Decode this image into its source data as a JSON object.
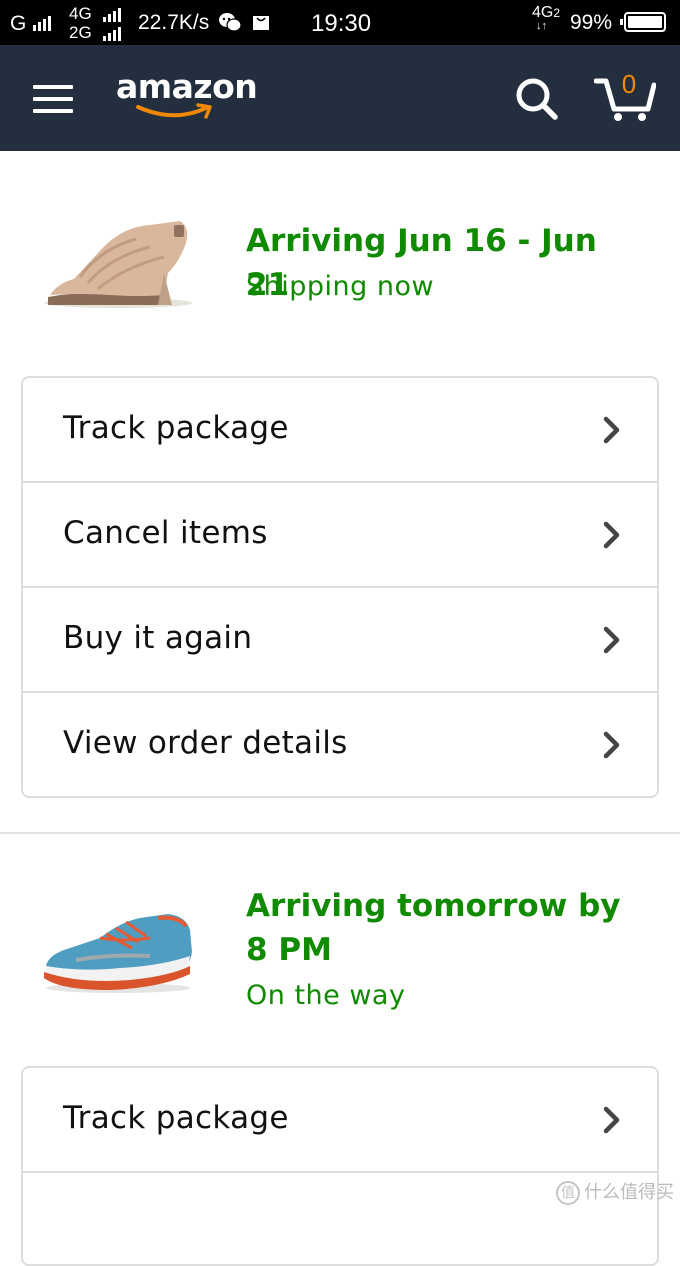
{
  "status_bar": {
    "carrier": "G",
    "network_top": "4G",
    "network_bottom": "2G",
    "speed": "22.7K/s",
    "time": "19:30",
    "network_right": "4G",
    "network_right_sub": "2",
    "battery": "99%",
    "battery_level": 0.99
  },
  "navbar": {
    "logo": "amazon",
    "cart_count": "0",
    "colors": {
      "background": "#232f3e",
      "accent": "#f08804"
    }
  },
  "orders": [
    {
      "arriving": "Arriving Jun 16 - Jun 21",
      "status": "Shipping now",
      "actions": [
        "Track package",
        "Cancel items",
        "Buy it again",
        "View order details"
      ]
    },
    {
      "arriving": "Arriving tomorrow by 8 PM",
      "status": "On the way",
      "actions": [
        "Track package",
        ""
      ]
    }
  ],
  "colors": {
    "status_green": "#108a00",
    "border": "#dddddd"
  },
  "watermark": {
    "text": "什么值得买",
    "mark": "值"
  }
}
